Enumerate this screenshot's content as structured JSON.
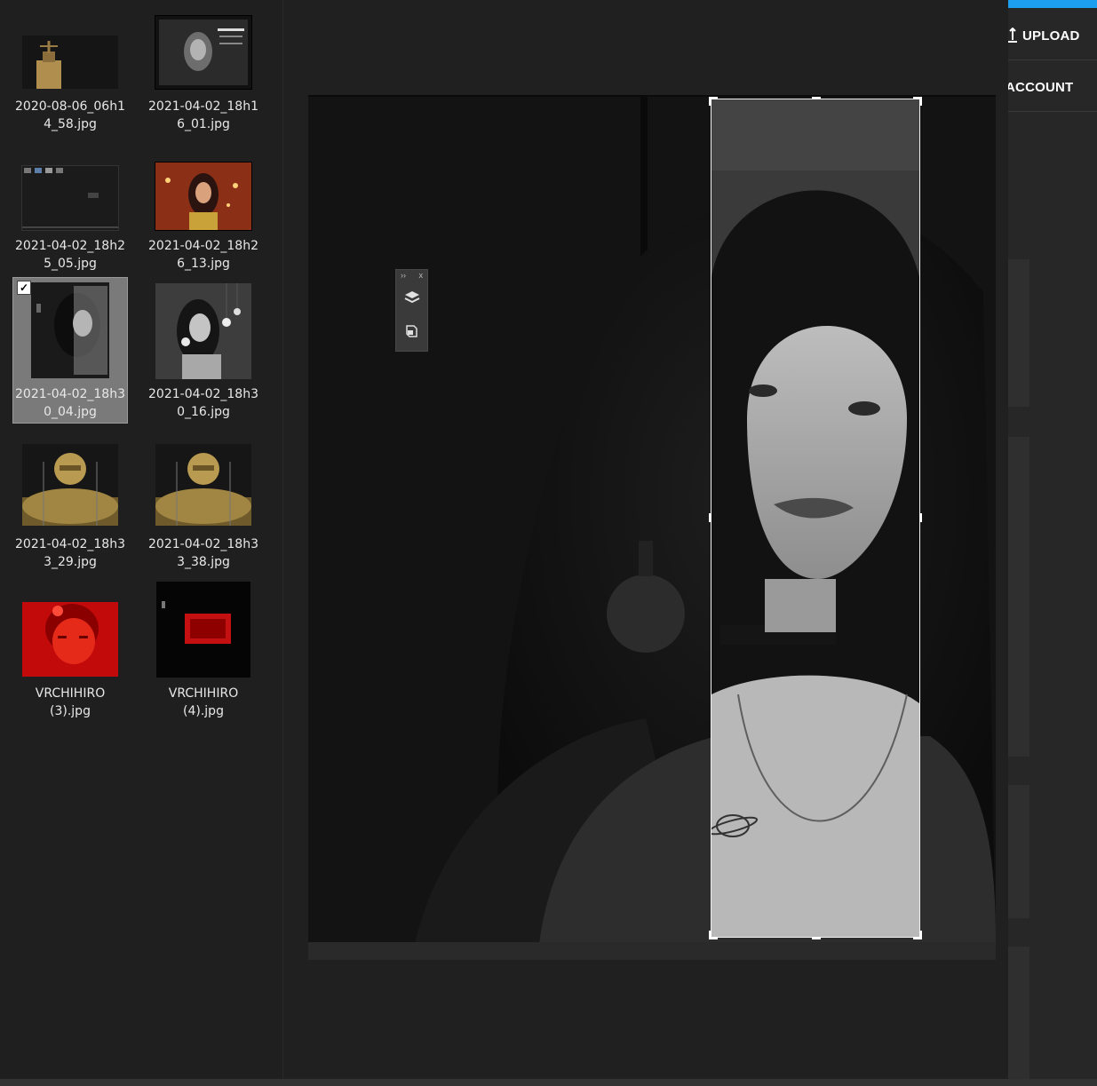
{
  "files": [
    {
      "name": "2020-08-06_06h14_58.jpg",
      "caption_line1": "2020-08-06_06h1",
      "caption_line2": "4_58.jpg",
      "selected": false
    },
    {
      "name": "2021-04-02_18h16_01.jpg",
      "caption_line1": "2021-04-02_18h1",
      "caption_line2": "6_01.jpg",
      "selected": false
    },
    {
      "name": "2021-04-02_18h25_05.jpg",
      "caption_line1": "2021-04-02_18h2",
      "caption_line2": "5_05.jpg",
      "selected": false
    },
    {
      "name": "2021-04-02_18h26_13.jpg",
      "caption_line1": "2021-04-02_18h2",
      "caption_line2": "6_13.jpg",
      "selected": false
    },
    {
      "name": "2021-04-02_18h30_04.jpg",
      "caption_line1": "2021-04-02_18h3",
      "caption_line2": "0_04.jpg",
      "selected": true
    },
    {
      "name": "2021-04-02_18h30_16.jpg",
      "caption_line1": "2021-04-02_18h3",
      "caption_line2": "0_16.jpg",
      "selected": false
    },
    {
      "name": "2021-04-02_18h33_29.jpg",
      "caption_line1": "2021-04-02_18h3",
      "caption_line2": "3_29.jpg",
      "selected": false
    },
    {
      "name": "2021-04-02_18h33_38.jpg",
      "caption_line1": "2021-04-02_18h3",
      "caption_line2": "3_38.jpg",
      "selected": false
    },
    {
      "name": "VRCHIHIRO (3).jpg",
      "caption_line1": "VRCHIHIRO",
      "caption_line2": "(3).jpg",
      "selected": false
    },
    {
      "name": "VRCHIHIRO (4).jpg",
      "caption_line1": "VRCHIHIRO",
      "caption_line2": "(4).jpg",
      "selected": false
    }
  ],
  "checkbox_glyph": "✓",
  "toolbar": {
    "expand_glyph": "››",
    "close_glyph": "x",
    "layers_icon": "layers-icon",
    "cube_icon": "cube-icon"
  },
  "nav": {
    "upload_label": "UPLOAD",
    "account_label": "ACCOUNT",
    "upload_icon": "upload-icon"
  },
  "colors": {
    "accent": "#1d9ff0",
    "selected_tile": "#7a7a7a",
    "background": "#202020"
  }
}
